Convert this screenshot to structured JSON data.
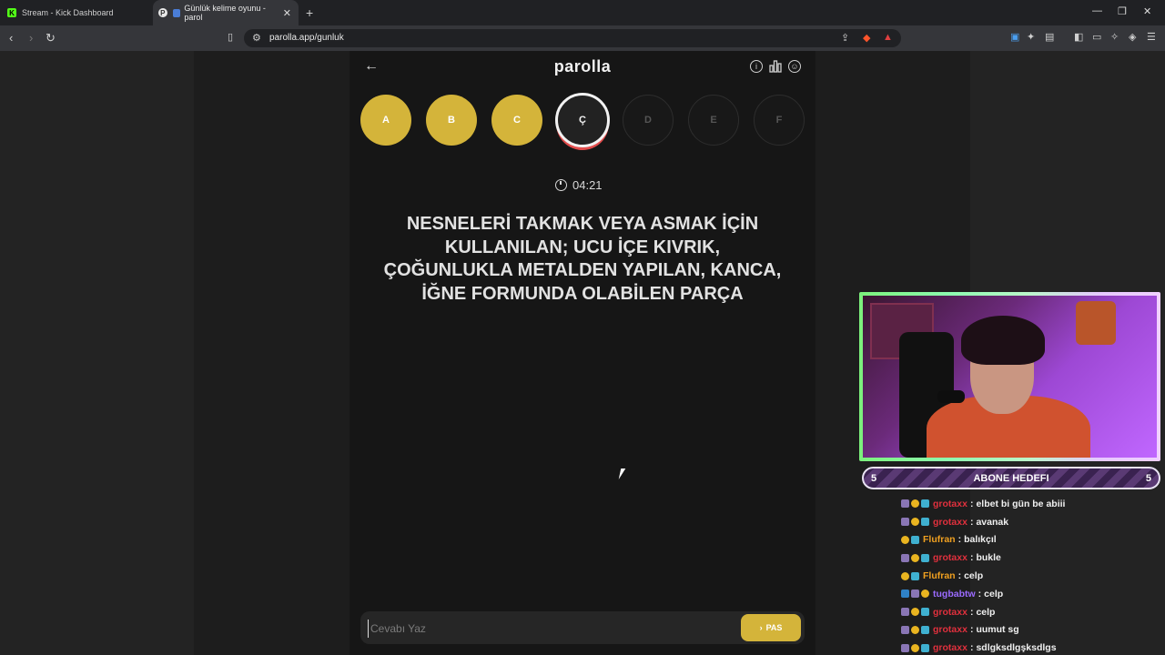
{
  "browser": {
    "tabs": [
      {
        "title": "Stream - Kick Dashboard",
        "favicon": "kick-icon",
        "active": false
      },
      {
        "title": "Günlük kelime oyunu - parol",
        "favicon": "parolla-icon",
        "active": true
      }
    ],
    "url": "parolla.app/gunluk"
  },
  "game": {
    "logo": "parolla",
    "letters": [
      {
        "letter": "A",
        "state": "done"
      },
      {
        "letter": "B",
        "state": "done"
      },
      {
        "letter": "C",
        "state": "done"
      },
      {
        "letter": "Ç",
        "state": "active"
      },
      {
        "letter": "D",
        "state": "pending"
      },
      {
        "letter": "E",
        "state": "pending"
      },
      {
        "letter": "F",
        "state": "pending"
      }
    ],
    "timer": "04:21",
    "question": "NESNELERİ TAKMAK VEYA ASMAK İÇİN KULLANILAN; UCU İÇE KIVRIK, ÇOĞUNLUKLA METALDEN YAPILAN, KANCA, İĞNE FORMUNDA OLABİLEN PARÇA",
    "input_placeholder": "Cevabı Yaz",
    "pass_label": "PAS",
    "accent_color": "#d4b43a"
  },
  "overlay": {
    "goal": {
      "label": "ABONE HEDEFI",
      "left": "5",
      "right": "5"
    },
    "chat": [
      {
        "badges": [
          "sub",
          "gold",
          "bot"
        ],
        "user": "grotaxx",
        "color": "#e0303d",
        "message": "elbet bi gün be abiii"
      },
      {
        "badges": [
          "sub",
          "gold",
          "bot"
        ],
        "user": "grotaxx",
        "color": "#e0303d",
        "message": "avanak"
      },
      {
        "badges": [
          "gold",
          "bot"
        ],
        "user": "Flufran",
        "color": "#f0a020",
        "message": "balıkçıl"
      },
      {
        "badges": [
          "sub",
          "gold",
          "bot"
        ],
        "user": "grotaxx",
        "color": "#e0303d",
        "message": "bukle"
      },
      {
        "badges": [
          "gold",
          "bot"
        ],
        "user": "Flufran",
        "color": "#f0a020",
        "message": "celp"
      },
      {
        "badges": [
          "star",
          "sub",
          "gold"
        ],
        "user": "tugbabtw",
        "color": "#9b6bff",
        "message": "celp"
      },
      {
        "badges": [
          "sub",
          "gold",
          "bot"
        ],
        "user": "grotaxx",
        "color": "#e0303d",
        "message": "celp"
      },
      {
        "badges": [
          "sub",
          "gold",
          "bot"
        ],
        "user": "grotaxx",
        "color": "#e0303d",
        "message": "uumut sg"
      },
      {
        "badges": [
          "sub",
          "gold",
          "bot"
        ],
        "user": "grotaxx",
        "color": "#e0303d",
        "message": "sdlgksdlgşksdlgs"
      }
    ]
  }
}
